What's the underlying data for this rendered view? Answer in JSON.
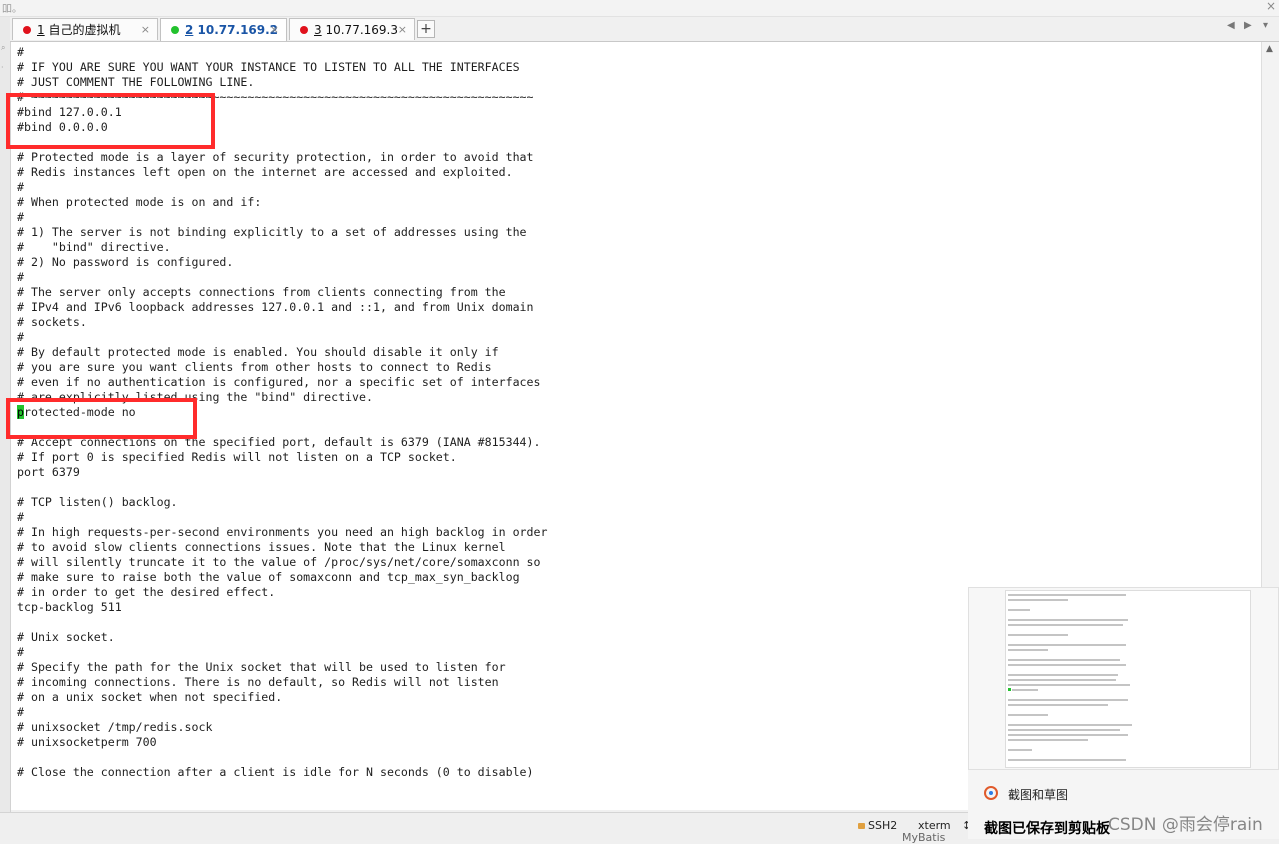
{
  "window": {
    "corner_text": "吅。",
    "close_glyph": "×"
  },
  "tabs": [
    {
      "num": "1",
      "title": "自己的虚拟机",
      "dot_color": "#e0111c",
      "active": false
    },
    {
      "num": "2",
      "title": "10.77.169.2",
      "dot_color": "#23c22e",
      "active": true
    },
    {
      "num": "3",
      "title": "10.77.169.3",
      "dot_color": "#e0111c",
      "active": false
    }
  ],
  "tab_close_glyph": "×",
  "new_tab_label": "+",
  "tab_nav": {
    "prev": "◀",
    "next": "▶",
    "menu": "▾"
  },
  "terminal": {
    "cursor_char": "p",
    "lines_before_cursor": [
      "#",
      "# IF YOU ARE SURE YOU WANT YOUR INSTANCE TO LISTEN TO ALL THE INTERFACES",
      "# JUST COMMENT THE FOLLOWING LINE.",
      "# ~~~~~~~~~~~~~~~~~~~~~~~~~~~~~~~~~~~~~~~~~~~~~~~~~~~~~~~~~~~~~~~~~~~~~~~~",
      "#bind 127.0.0.1",
      "#bind 0.0.0.0",
      "",
      "# Protected mode is a layer of security protection, in order to avoid that",
      "# Redis instances left open on the internet are accessed and exploited.",
      "#",
      "# When protected mode is on and if:",
      "#",
      "# 1) The server is not binding explicitly to a set of addresses using the",
      "#    \"bind\" directive.",
      "# 2) No password is configured.",
      "#",
      "# The server only accepts connections from clients connecting from the",
      "# IPv4 and IPv6 loopback addresses 127.0.0.1 and ::1, and from Unix domain",
      "# sockets.",
      "#",
      "# By default protected mode is enabled. You should disable it only if",
      "# you are sure you want clients from other hosts to connect to Redis",
      "# even if no authentication is configured, nor a specific set of interfaces",
      "# are explicitly listed using the \"bind\" directive."
    ],
    "cursor_line_rest": "rotected-mode no",
    "lines_after_cursor": [
      "",
      "# Accept connections on the specified port, default is 6379 (IANA #815344).",
      "# If port 0 is specified Redis will not listen on a TCP socket.",
      "port 6379",
      "",
      "# TCP listen() backlog.",
      "#",
      "# In high requests-per-second environments you need an high backlog in order",
      "# to avoid slow clients connections issues. Note that the Linux kernel",
      "# will silently truncate it to the value of /proc/sys/net/core/somaxconn so",
      "# make sure to raise both the value of somaxconn and tcp_max_syn_backlog",
      "# in order to get the desired effect.",
      "tcp-backlog 511",
      "",
      "# Unix socket.",
      "#",
      "# Specify the path for the Unix socket that will be used to listen for",
      "# incoming connections. There is no default, so Redis will not listen",
      "# on a unix socket when not specified.",
      "#",
      "# unixsocket /tmp/redis.sock",
      "# unixsocketperm 700",
      "",
      "# Close the connection after a client is idle for N seconds (0 to disable)"
    ]
  },
  "status_bar": {
    "protocol": "SSH2",
    "terminal_type": "xterm",
    "size_glyph": "↕",
    "app_partial": "MyBatis"
  },
  "notification": {
    "app_name": "截图和草图",
    "title": "截图已保存到剪贴板"
  },
  "watermark": "CSDN @雨会停rain",
  "colors": {
    "highlight": "#ff2b2b",
    "cursor": "#23c22e",
    "active_tab_text": "#1a55a6"
  }
}
